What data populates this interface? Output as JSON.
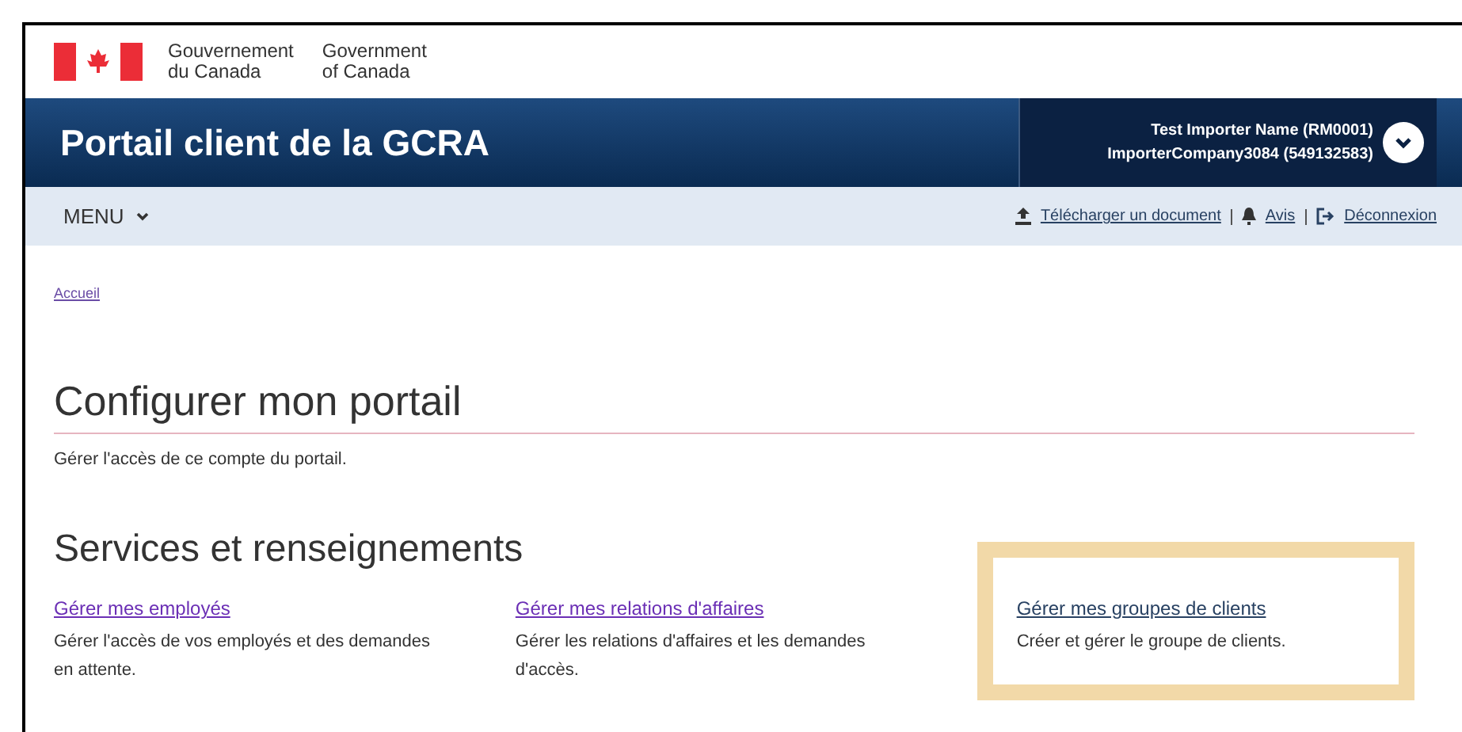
{
  "gov_signature": {
    "fr_line1": "Gouvernement",
    "fr_line2": "du Canada",
    "en_line1": "Government",
    "en_line2": "of Canada"
  },
  "app_bar": {
    "title": "Portail client de la GCRA",
    "user_line1": "Test Importer Name (RM0001)",
    "user_line2": "ImporterCompany3084 (549132583)"
  },
  "menu_bar": {
    "menu_label": "MENU",
    "links": [
      {
        "kind": "upload",
        "label": "Télécharger un document"
      },
      {
        "kind": "bell",
        "label": "Avis"
      },
      {
        "kind": "logout",
        "label": "Déconnexion"
      }
    ]
  },
  "breadcrumb": "Accueil",
  "page": {
    "title": "Configurer mon portail",
    "description": "Gérer l'accès de ce compte du portail."
  },
  "services": {
    "title": "Services et renseignements",
    "cards": [
      {
        "link": "Gérer mes employés",
        "description": "Gérer l'accès de vos employés et des demandes en attente.",
        "visited": true,
        "highlighted": false
      },
      {
        "link": "Gérer mes relations d'affaires",
        "description": "Gérer les relations d'affaires et les demandes d'accès.",
        "visited": true,
        "highlighted": false
      },
      {
        "link": "Gérer mes groupes de clients",
        "description": "Créer et gérer le groupe de clients.",
        "visited": false,
        "highlighted": true
      }
    ]
  }
}
